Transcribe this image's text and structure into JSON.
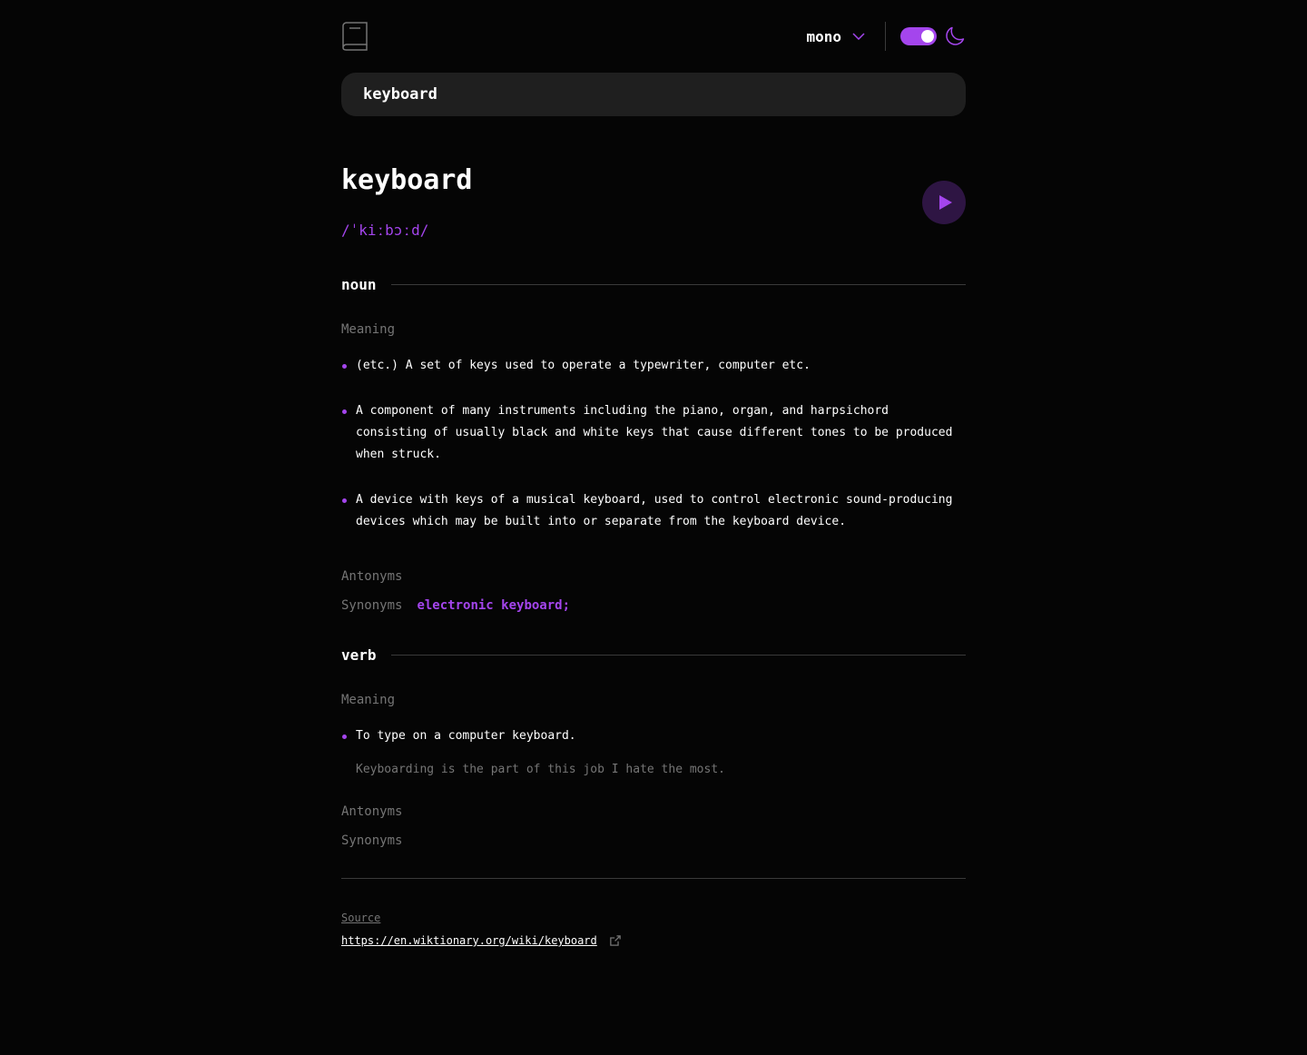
{
  "header": {
    "font_selector": {
      "selected": "mono"
    },
    "theme": {
      "mode": "dark",
      "toggle_on": true
    },
    "accent_color": "#a445ed"
  },
  "search": {
    "value": "keyboard",
    "placeholder": ""
  },
  "entry": {
    "word": "keyboard",
    "phonetic": "/ˈkiːbɔːd/",
    "meanings": [
      {
        "part_of_speech": "noun",
        "meaning_label": "Meaning",
        "definitions": [
          {
            "text": "(etc.) A set of keys used to operate a typewriter, computer etc."
          },
          {
            "text": "A component of many instruments including the piano, organ, and harpsichord consisting of usually black and white keys that cause different tones to be produced when struck."
          },
          {
            "text": "A device with keys of a musical keyboard, used to control electronic sound-producing devices which may be built into or separate from the keyboard device."
          }
        ],
        "antonyms_label": "Antonyms",
        "synonyms_label": "Synonyms",
        "synonyms": "electronic keyboard;"
      },
      {
        "part_of_speech": "verb",
        "meaning_label": "Meaning",
        "definitions": [
          {
            "text": "To type on a computer keyboard.",
            "example": "Keyboarding is the part of this job I hate the most."
          }
        ],
        "antonyms_label": "Antonyms",
        "synonyms_label": "Synonyms"
      }
    ]
  },
  "footer": {
    "source_label": "Source",
    "source_url": "https://en.wiktionary.org/wiki/keyboard"
  }
}
